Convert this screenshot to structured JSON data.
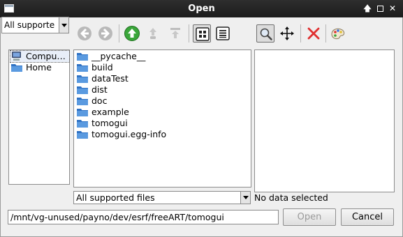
{
  "window": {
    "title": "Open"
  },
  "toolbar": {
    "filter_value": "All supporte",
    "buttons": [
      {
        "name": "back",
        "icon": "back-arrow-icon",
        "enabled": false
      },
      {
        "name": "forward",
        "icon": "forward-arrow-icon",
        "enabled": false
      },
      {
        "name": "parent-directory",
        "icon": "up-arrow-icon",
        "enabled": true
      },
      {
        "name": "home",
        "icon": "home-icon",
        "enabled": false
      },
      {
        "name": "root",
        "icon": "root-icon",
        "enabled": false
      },
      {
        "name": "icon-view",
        "icon": "grid-view-icon",
        "toggled": true
      },
      {
        "name": "detail-view",
        "icon": "list-view-icon",
        "toggled": false
      },
      {
        "name": "zoom",
        "icon": "magnifier-icon",
        "toggled": true
      },
      {
        "name": "pan",
        "icon": "move-icon"
      },
      {
        "name": "clear",
        "icon": "red-x-icon"
      },
      {
        "name": "colormap",
        "icon": "palette-icon"
      }
    ]
  },
  "sidebar": {
    "items": [
      {
        "label": "Compu…",
        "icon": "computer-icon",
        "selected": true
      },
      {
        "label": "Home",
        "icon": "folder-icon",
        "selected": false
      }
    ]
  },
  "files": {
    "items": [
      {
        "label": "__pycache__"
      },
      {
        "label": "build"
      },
      {
        "label": "dataTest"
      },
      {
        "label": "dist"
      },
      {
        "label": "doc"
      },
      {
        "label": "example"
      },
      {
        "label": "tomogui"
      },
      {
        "label": "tomogui.egg-info"
      }
    ]
  },
  "file_filter": {
    "selected": "All supported files"
  },
  "preview": {
    "status": "No data selected"
  },
  "path_input": {
    "value": "/mnt/vg-unused/payno/dev/esrf/freeART/tomogui"
  },
  "buttons": {
    "open": "Open",
    "cancel": "Cancel"
  },
  "colors": {
    "titlebar": "#262626",
    "folder": "#4d8fd6",
    "accent_green": "#3aa63a",
    "clear_red": "#e03030"
  }
}
